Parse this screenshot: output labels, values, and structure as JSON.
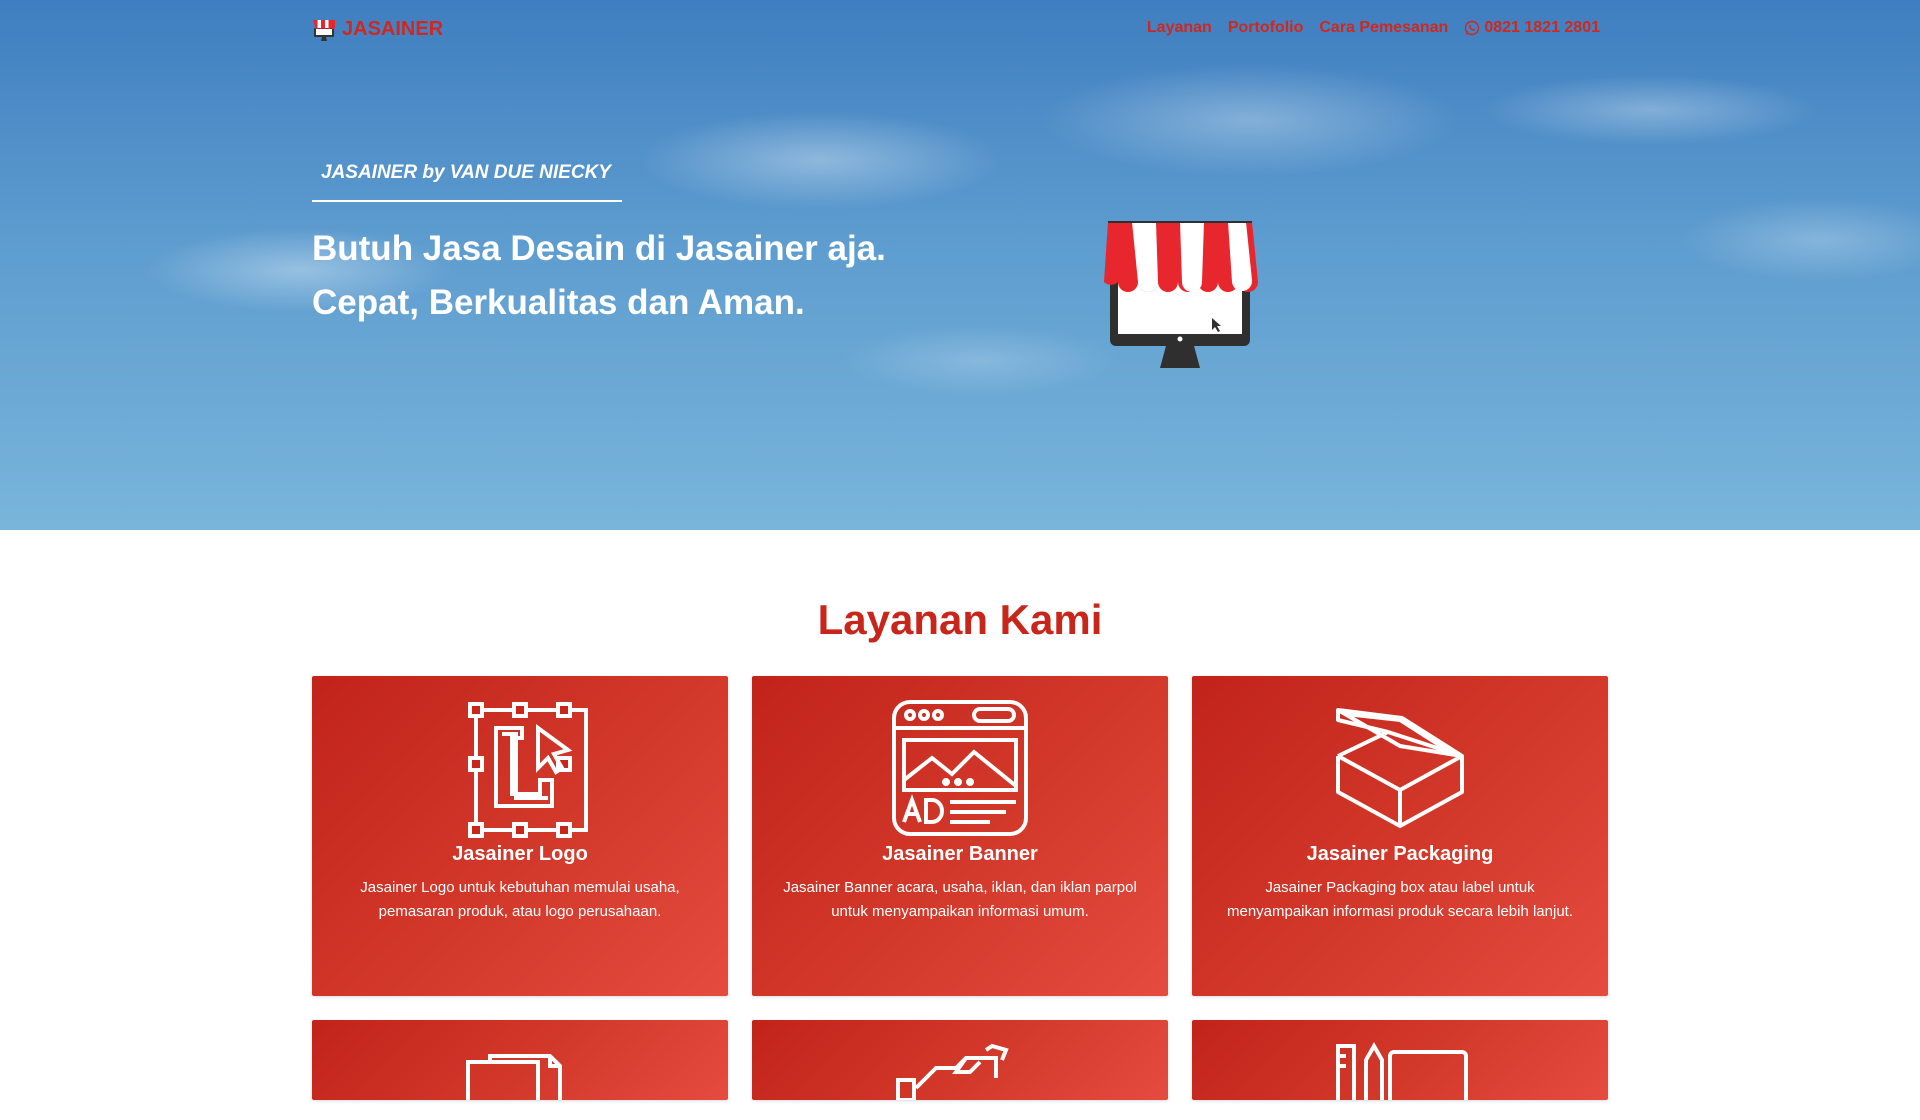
{
  "brand": {
    "name": "JASAINER",
    "icon": "store-icon"
  },
  "nav": {
    "links": [
      "Layanan",
      "Portofolio",
      "Cara Pemesanan"
    ],
    "phone": "0821 1821 2801",
    "phone_icon": "whatsapp-icon"
  },
  "hero": {
    "tagline": "JASAINER by VAN DUE NIECKY",
    "headline_line1": "Butuh Jasa Desain di Jasainer aja.",
    "headline_line2": "Cepat, Berkualitas dan Aman.",
    "illustration": "storefront-monitor-icon"
  },
  "services": {
    "title": "Layanan Kami",
    "cards": [
      {
        "icon": "logo-design-icon",
        "title": "Jasainer Logo",
        "desc": "Jasainer Logo untuk kebutuhan memulai usaha, pemasaran produk, atau logo perusahaan."
      },
      {
        "icon": "banner-ad-icon",
        "title": "Jasainer Banner",
        "desc": "Jasainer Banner acara, usaha, iklan, dan iklan parpol untuk menyampaikan informasi umum."
      },
      {
        "icon": "packaging-box-icon",
        "title": "Jasainer Packaging",
        "desc": "Jasainer Packaging box atau label untuk menyampaikan informasi produk secara lebih lanjut."
      },
      {
        "icon": "documents-icon"
      },
      {
        "icon": "handshake-icon"
      },
      {
        "icon": "design-tools-icon"
      }
    ]
  },
  "colors": {
    "brand_red": "#d0281e",
    "card_red": "#c1231a",
    "sky_blue": "#5d9ccf"
  }
}
